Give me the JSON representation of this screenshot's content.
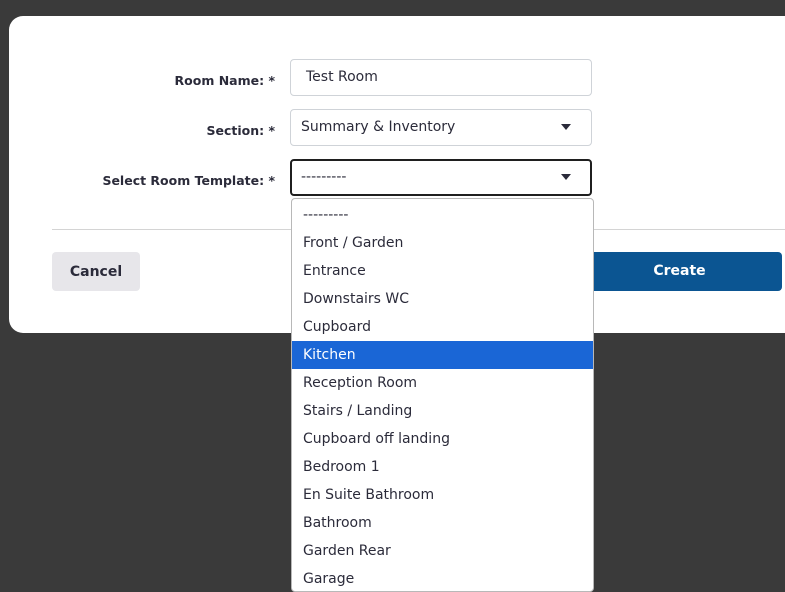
{
  "form": {
    "room_name": {
      "label": "Room Name: *",
      "value": "Test Room"
    },
    "section": {
      "label": "Section: *",
      "value": "Summary & Inventory"
    },
    "template": {
      "label": "Select Room Template: *",
      "value": "---------"
    }
  },
  "buttons": {
    "cancel_label": "Cancel",
    "create_label": "Create"
  },
  "dropdown": {
    "highlighted": "Kitchen",
    "options": [
      "---------",
      "Front / Garden",
      "Entrance",
      "Downstairs WC",
      "Cupboard",
      "Kitchen",
      "Reception Room",
      "Stairs / Landing",
      "Cupboard off landing",
      "Bedroom 1",
      "En Suite Bathroom",
      "Bathroom",
      "Garden Rear",
      "Garage"
    ]
  },
  "colors": {
    "backdrop": "#3a3a3a",
    "primary_button": "#0b5592",
    "option_highlight": "#1a66d6"
  }
}
